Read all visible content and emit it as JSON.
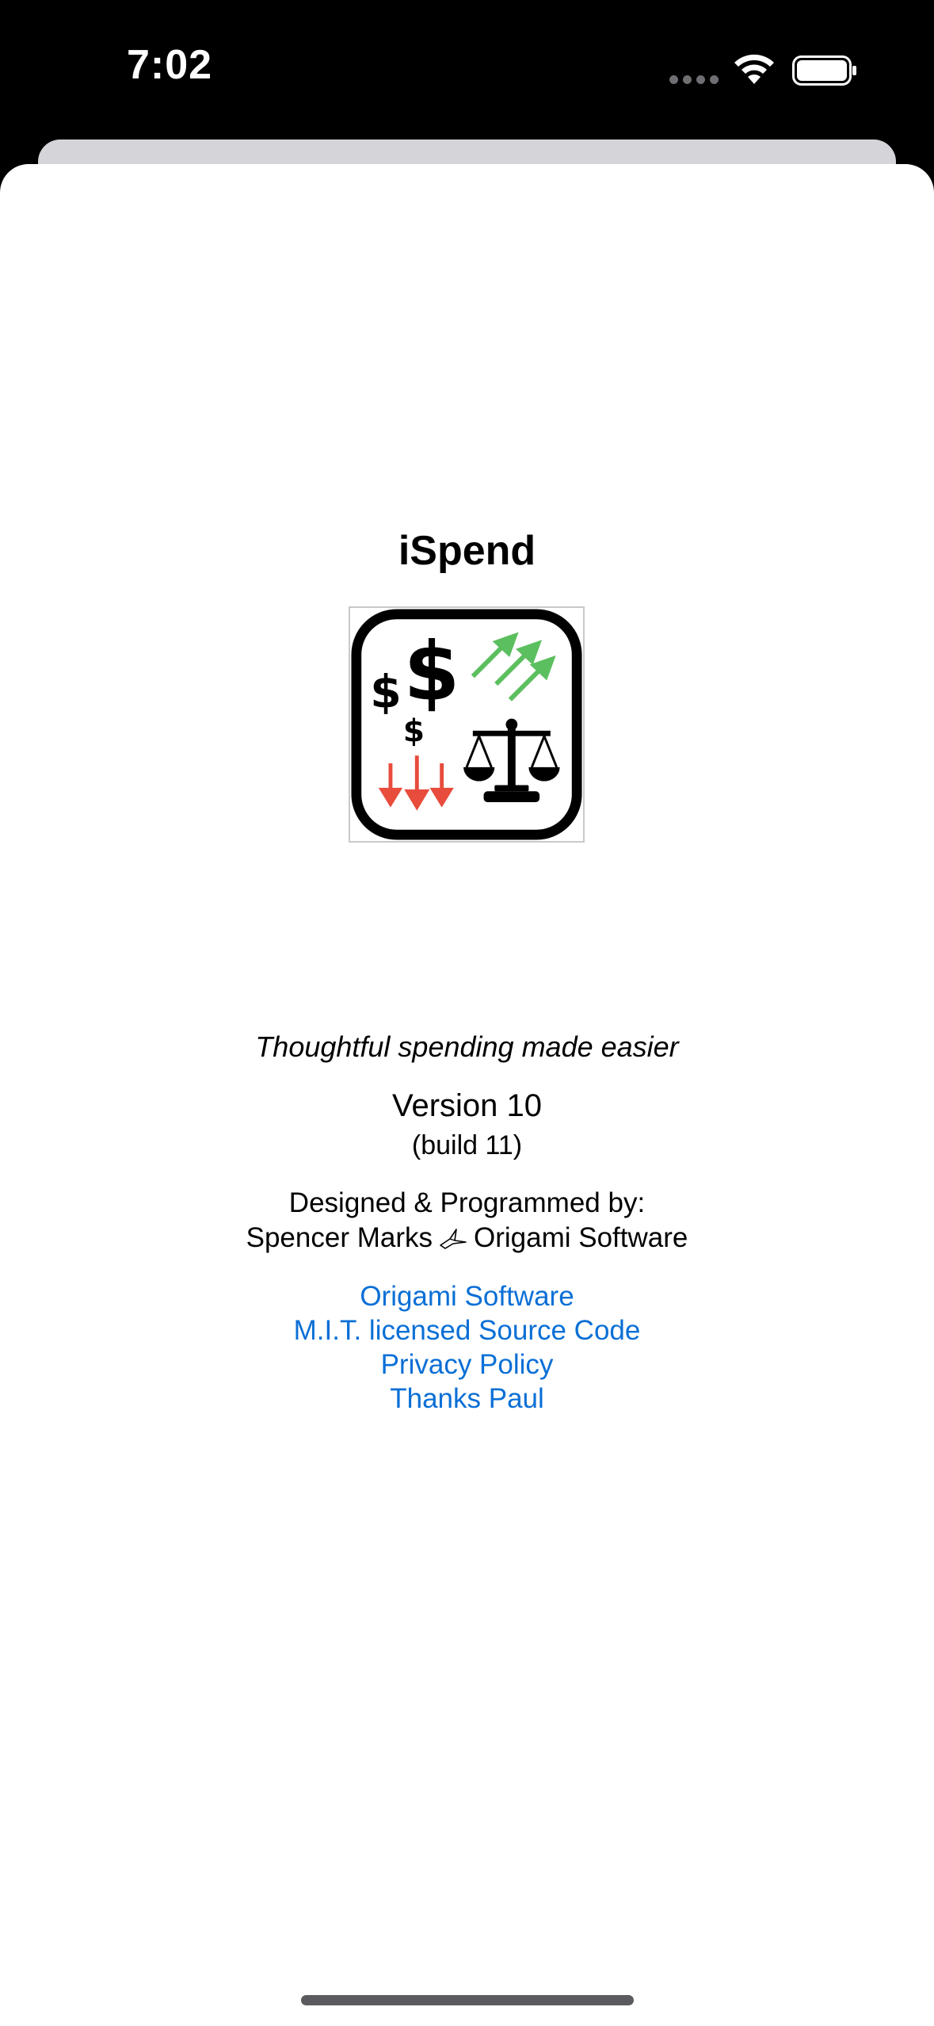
{
  "status_bar": {
    "time": "7:02"
  },
  "about": {
    "app_name": "iSpend",
    "logo_symbols": {
      "big_dollar": "$",
      "medium_dollar": "$",
      "small_dollar": "$"
    },
    "tagline": "Thoughtful spending made easier",
    "version": "Version 10",
    "build": "(build 11)",
    "designed_by_label": "Designed & Programmed by:",
    "author": "Spencer Marks",
    "company": "Origami Software",
    "links": [
      {
        "label": "Origami Software"
      },
      {
        "label": "M.I.T. licensed Source Code"
      },
      {
        "label": "Privacy Policy"
      },
      {
        "label": "Thanks Paul"
      }
    ]
  },
  "colors": {
    "link": "#0a6fd6",
    "up_arrows": "#5cbf5f",
    "down_arrows": "#e74c3c"
  }
}
